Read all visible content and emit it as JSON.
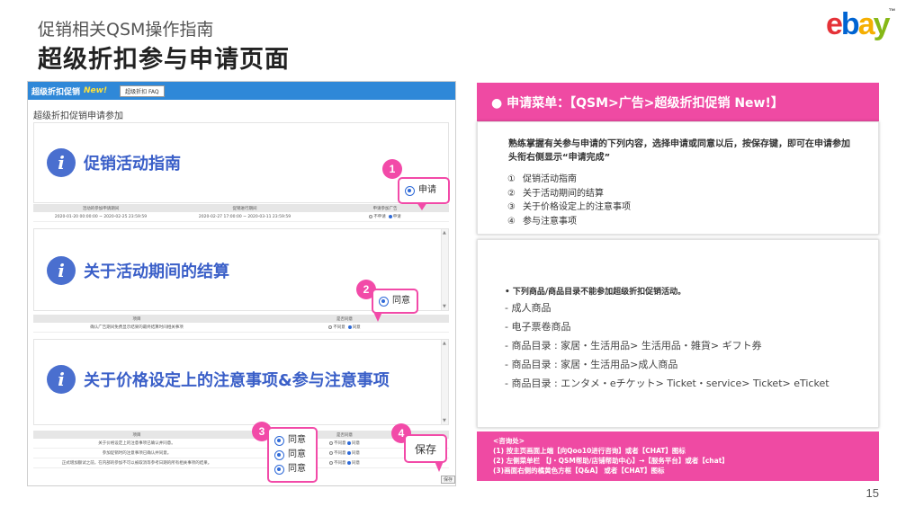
{
  "header": {
    "subtitle": "促销相关QSM操作指南",
    "title": "超级折扣参与申请页面",
    "page_number": "15"
  },
  "logo": {
    "letters": [
      {
        "ch": "e",
        "color": "#e53238"
      },
      {
        "ch": "b",
        "color": "#0064d2"
      },
      {
        "ch": "a",
        "color": "#f5af02"
      },
      {
        "ch": "y",
        "color": "#86b817"
      }
    ],
    "tm": "™"
  },
  "screenshot": {
    "header_title": "超级折扣促销",
    "header_new": "New!",
    "faq_button": "超级折扣 FAQ",
    "subtitle": "超级折扣促销申请参加",
    "sections": [
      {
        "title": "促销活动指南"
      },
      {
        "title": "关于活动期间的结算"
      },
      {
        "title": "关于价格设定上的注意事项&参与注意事项"
      }
    ],
    "table1": {
      "headers": [
        "活动的参加申请期间",
        "促销进行期间",
        "申请参加广告"
      ],
      "row": [
        "2020-01-20 00:00:00 ~ 2020-02-25 23:59:59",
        "2020-02-27 17:00:00 ~ 2020-03-11 23:59:59"
      ],
      "radio_no": "不申请",
      "radio_yes": "申请"
    },
    "table2": {
      "headers": [
        "项目",
        "是否同意"
      ],
      "row": "确认广告期间免费显示结果的最终结算时间相关事项",
      "radio_no": "不同意",
      "radio_yes": "同意"
    },
    "table3": {
      "headers": [
        "项目",
        "是否同意"
      ],
      "rows": [
        "关于价格设定上的注意事项已确认并同意。",
        "参加促销时的注意事项已确认并同意。",
        "正式增加额试之前，在内部的参加不可以被取消等参考日期的所有相关事项的结果。"
      ],
      "radio_no": "不同意",
      "radio_yes": "同意"
    },
    "save_mini": "保存",
    "callouts": {
      "c1": {
        "number": "1",
        "label": "申请"
      },
      "c2": {
        "number": "2",
        "label": "同意"
      },
      "c3": {
        "number": "3",
        "labels": [
          "同意",
          "同意",
          "同意"
        ]
      },
      "c4": {
        "number": "4",
        "label": "保存"
      }
    }
  },
  "right": {
    "menu_bar": "● 申请菜单：【QSM>广告>超级折扣促销 New!】",
    "intro": "熟练掌握有关参与申请的下列内容，选择申请或同意以后，按保存键，即可在申请参加头衔右侧显示“申请完成”",
    "list": [
      {
        "mark": "①",
        "text": "促销活动指南"
      },
      {
        "mark": "②",
        "text": "关于活动期间的结算"
      },
      {
        "mark": "③",
        "text": "关于价格设定上的注意事项"
      },
      {
        "mark": "④",
        "text": "参与注意事项"
      }
    ],
    "note": "•   下列商品/商品目录不能参加超级折扣促销活动。",
    "excluded": [
      "- 成人商品",
      "- 电子票卷商品",
      "- 商品目录 : 家居・生活用品> 生活用品・雑貨> ギフト券",
      "- 商品目录 : 家居・生活用品>成人商品",
      "- 商品目录 : エンタメ・eチケット> Ticket・service> Ticket> eTicket"
    ],
    "contact_lines": [
      "<咨询处>",
      "(1) 按主页画面上端【向Qoo10进行咨询】或者【CHAT】图标",
      "(2) 左侧菜单栏 【J・QSM帮助/店铺帮助中心】→【服务平台】或者【chat】",
      "(3)画面右侧的橘黄色方框【Q&A】 或者【CHAT】图标"
    ]
  },
  "colors": {
    "accent_pink": "#ef4aa3",
    "info_blue": "#4a6fcf",
    "header_blue": "#2f88d8"
  }
}
